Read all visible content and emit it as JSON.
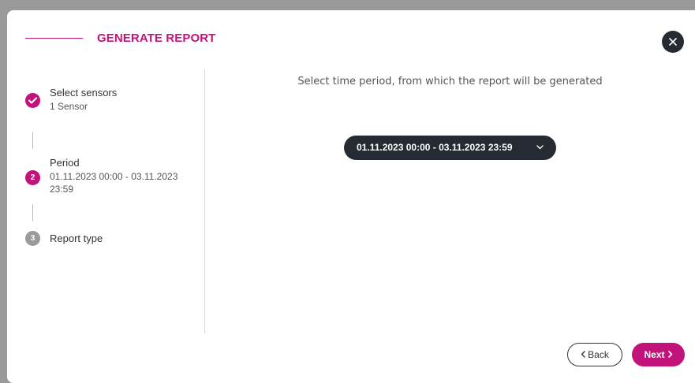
{
  "dialog": {
    "title": "GENERATE REPORT",
    "colors": {
      "accent": "#c2137a",
      "dark": "#262a33",
      "pending": "#9b9b9b"
    }
  },
  "steps": [
    {
      "index": "1",
      "title": "Select sensors",
      "subtitle": "1 Sensor",
      "state": "done",
      "icon": "check-icon"
    },
    {
      "index": "2",
      "title": "Period",
      "subtitle": "01.11.2023 00:00 - 03.11.2023 23:59",
      "state": "active"
    },
    {
      "index": "3",
      "title": "Report type",
      "subtitle": "",
      "state": "pending"
    }
  ],
  "main": {
    "caption": "Select time period, from which the report will be generated",
    "period_value": "01.11.2023 00:00 - 03.11.2023 23:59"
  },
  "footer": {
    "back_label": "Back",
    "next_label": "Next"
  }
}
